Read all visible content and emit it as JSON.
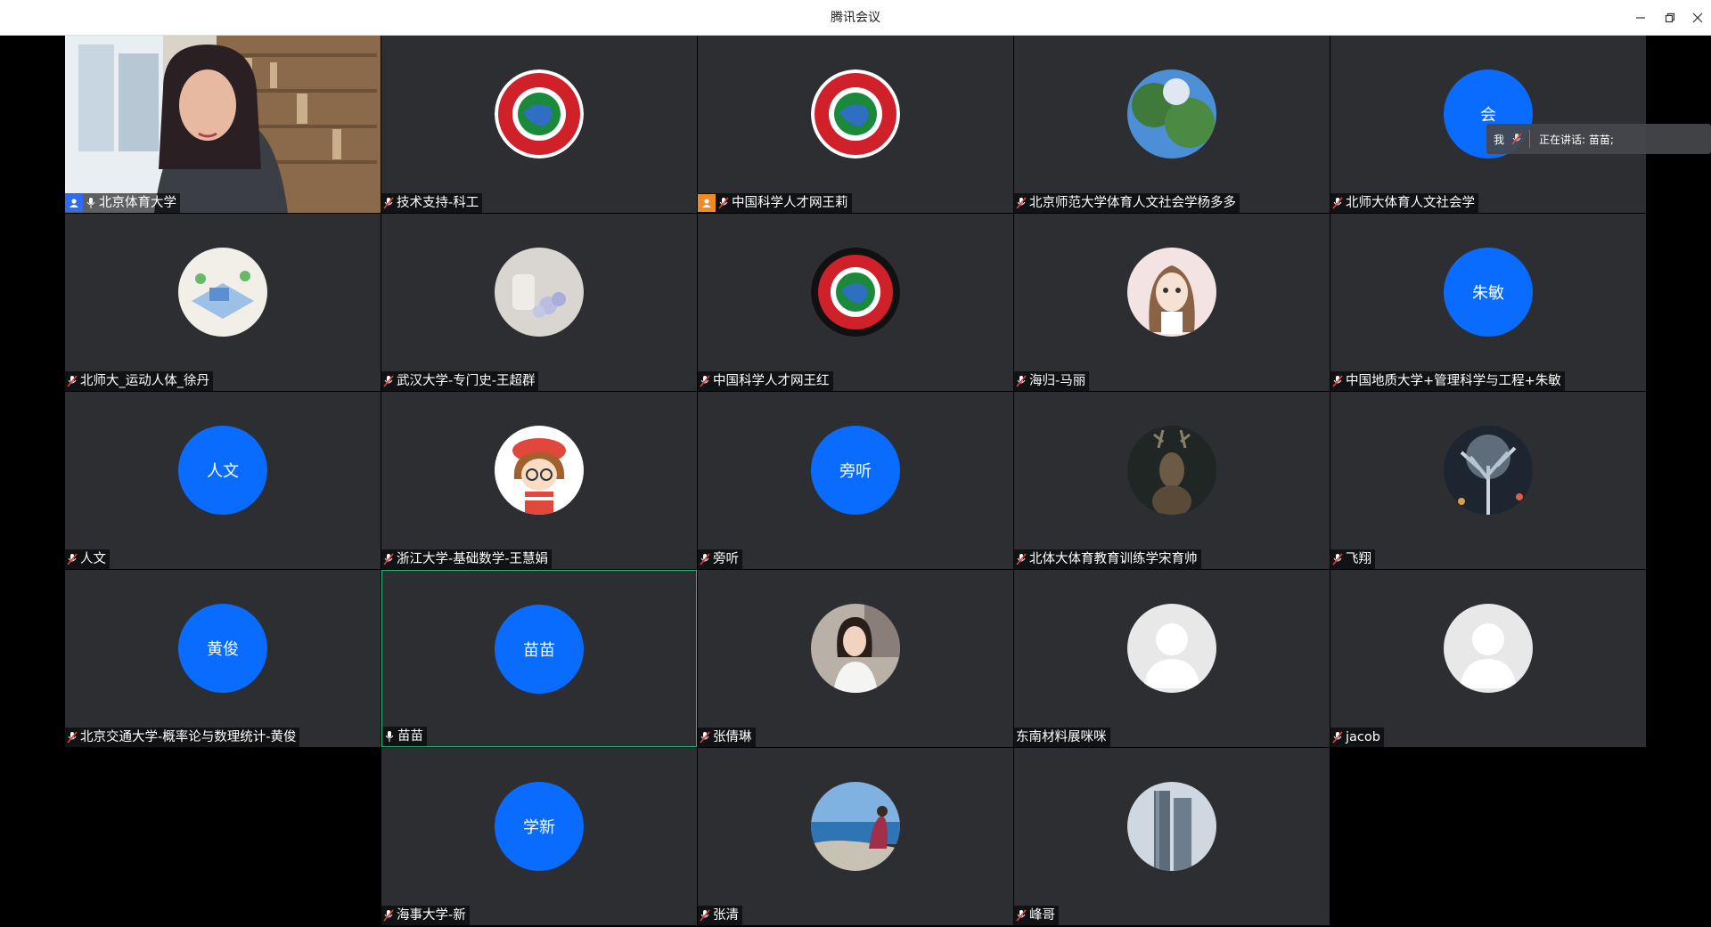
{
  "window": {
    "title": "腾讯会议"
  },
  "speaking_toast": {
    "me_label": "我",
    "speaking_label": "正在讲话: 苗苗;"
  },
  "participants": [
    {
      "name": "北京体育大学",
      "avatar_text": ""
    },
    {
      "name": "技术支持-科工",
      "avatar_text": ""
    },
    {
      "name": "中国科学人才网王莉",
      "avatar_text": ""
    },
    {
      "name": "北京师范大学体育人文社会学杨多多",
      "avatar_text": ""
    },
    {
      "name": "北师大体育人文社会学",
      "avatar_text": "会"
    },
    {
      "name": "北师大_运动人体_徐丹",
      "avatar_text": ""
    },
    {
      "name": "武汉大学-专门史-王超群",
      "avatar_text": ""
    },
    {
      "name": "中国科学人才网王红",
      "avatar_text": ""
    },
    {
      "name": "海归-马丽",
      "avatar_text": ""
    },
    {
      "name": "中国地质大学+管理科学与工程+朱敏",
      "avatar_text": "朱敏"
    },
    {
      "name": "人文",
      "avatar_text": "人文"
    },
    {
      "name": "浙江大学-基础数学-王慧娟",
      "avatar_text": ""
    },
    {
      "name": "旁听",
      "avatar_text": "旁听"
    },
    {
      "name": "北体大体育教育训练学宋育帅",
      "avatar_text": ""
    },
    {
      "name": "飞翔",
      "avatar_text": ""
    },
    {
      "name": "北京交通大学-概率论与数理统计-黄俊",
      "avatar_text": "黄俊"
    },
    {
      "name": "苗苗",
      "avatar_text": "苗苗"
    },
    {
      "name": "张倩琳",
      "avatar_text": ""
    },
    {
      "name": "东南材料展咪咪",
      "avatar_text": ""
    },
    {
      "name": "jacob",
      "avatar_text": ""
    },
    {
      "name": "海事大学-新",
      "avatar_text": "学新"
    },
    {
      "name": "张清",
      "avatar_text": ""
    },
    {
      "name": "峰哥",
      "avatar_text": ""
    }
  ],
  "colors": {
    "tile_bg": "#2c2e31",
    "avatar_blue": "#0a6cff",
    "active_border": "#2bb673",
    "muted_mic": "#e04040"
  }
}
